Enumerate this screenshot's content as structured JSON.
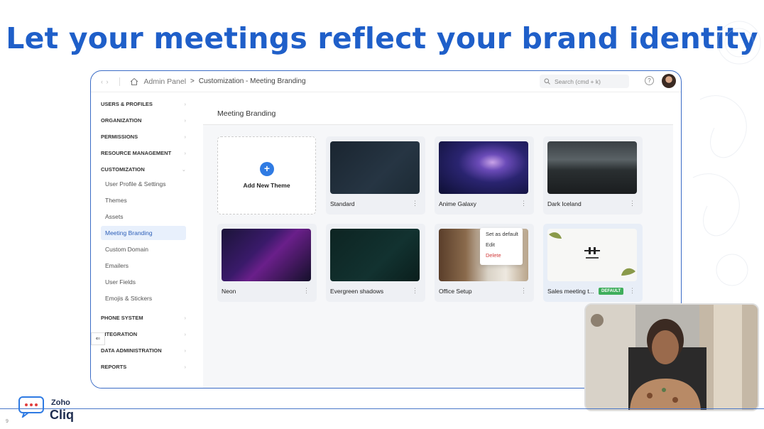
{
  "slide": {
    "headline": "Let your meetings reflect your brand identity",
    "page_number": "9",
    "brand_top": "Zoho",
    "brand_bottom": "Cliq",
    "logo_icon": "chat-bubble-icon"
  },
  "app": {
    "breadcrumb": {
      "root": "Admin Panel",
      "separator": ">",
      "current": "Customization - Meeting Branding"
    },
    "search": {
      "placeholder": "Search (cmd + k)"
    },
    "help_label": "?"
  },
  "sidebar": {
    "sections": [
      {
        "label": "USERS & PROFILES"
      },
      {
        "label": "ORGANIZATION"
      },
      {
        "label": "PERMISSIONS"
      },
      {
        "label": "RESOURCE MANAGEMENT"
      },
      {
        "label": "CUSTOMIZATION"
      }
    ],
    "customization_items": [
      {
        "label": "User Profile & Settings"
      },
      {
        "label": "Themes"
      },
      {
        "label": "Assets"
      },
      {
        "label": "Meeting Branding"
      },
      {
        "label": "Custom Domain"
      },
      {
        "label": "Emailers"
      },
      {
        "label": "User Fields"
      },
      {
        "label": "Emojis & Stickers"
      }
    ],
    "lower_sections": [
      {
        "label": "PHONE SYSTEM"
      },
      {
        "label": "INTEGRATION"
      },
      {
        "label": "DATA ADMINISTRATION"
      },
      {
        "label": "REPORTS"
      }
    ],
    "active_item": "Meeting Branding"
  },
  "main": {
    "title": "Meeting Branding",
    "add_label": "Add New Theme",
    "themes": [
      {
        "label": "Standard"
      },
      {
        "label": "Anime Galaxy"
      },
      {
        "label": "Dark Iceland"
      },
      {
        "label": "Neon"
      },
      {
        "label": "Evergreen shadows"
      },
      {
        "label": "Office Setup"
      },
      {
        "label": "Sales meeting t...",
        "badge": "DEFAULT"
      }
    ],
    "context_menu": [
      "Set as default",
      "Edit",
      "Delete"
    ],
    "context_menu_visible": [
      "Set as default",
      "Ed",
      "De"
    ]
  },
  "colors": {
    "headline": "#1f5fc9",
    "accent": "#2f7be3",
    "default_badge": "#3fae5c",
    "frame_border": "#3b6cc6"
  }
}
